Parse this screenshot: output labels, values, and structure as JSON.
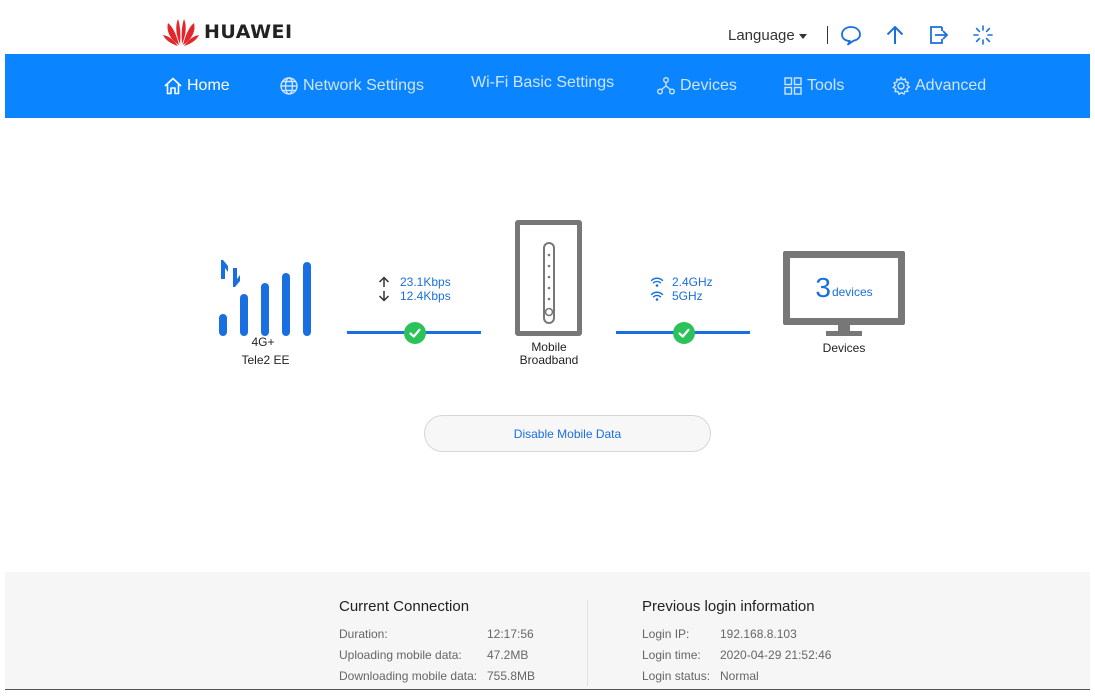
{
  "brand": {
    "name": "HUAWEI",
    "logo_color": "#e3262b"
  },
  "header": {
    "language_label": "Language",
    "icons": [
      "message-icon",
      "update-icon",
      "logout-icon",
      "loading-icon"
    ]
  },
  "nav": {
    "bar_color": "#0a84ff",
    "items": [
      {
        "label": "Home",
        "icon": "home-icon",
        "active": true
      },
      {
        "label": "Network Settings",
        "icon": "globe-icon",
        "active": false
      },
      {
        "label": "Wi-Fi Basic Settings",
        "icon": "",
        "active": false
      },
      {
        "label": "Devices",
        "icon": "devices-icon",
        "active": false
      },
      {
        "label": "Tools",
        "icon": "tools-icon",
        "active": false
      },
      {
        "label": "Advanced",
        "icon": "gear-icon",
        "active": false
      }
    ]
  },
  "status": {
    "network_type": "4G+",
    "operator": "Tele2 EE",
    "upload_rate": "23.1Kbps",
    "download_rate": "12.4Kbps",
    "router_label_line1": "Mobile",
    "router_label_line2": "Broadband",
    "wifi_band_1": "2.4GHz",
    "wifi_band_2": "5GHz",
    "device_count": "3",
    "device_unit": "devices",
    "devices_label": "Devices",
    "accent_color": "#1a6fe0",
    "ok_color": "#2bc25a"
  },
  "actions": {
    "disable_mobile_data": "Disable Mobile Data"
  },
  "current_connection": {
    "title": "Current Connection",
    "rows": [
      {
        "label": "Duration:",
        "value": "12:17:56"
      },
      {
        "label": "Uploading mobile data:",
        "value": "47.2MB"
      },
      {
        "label": "Downloading mobile data:",
        "value": "755.8MB"
      }
    ]
  },
  "previous_login": {
    "title": "Previous login information",
    "rows": [
      {
        "label": "Login IP:",
        "value": "192.168.8.103"
      },
      {
        "label": "Login time:",
        "value": "2020-04-29 21:52:46"
      },
      {
        "label": "Login status:",
        "value": "Normal"
      }
    ]
  }
}
